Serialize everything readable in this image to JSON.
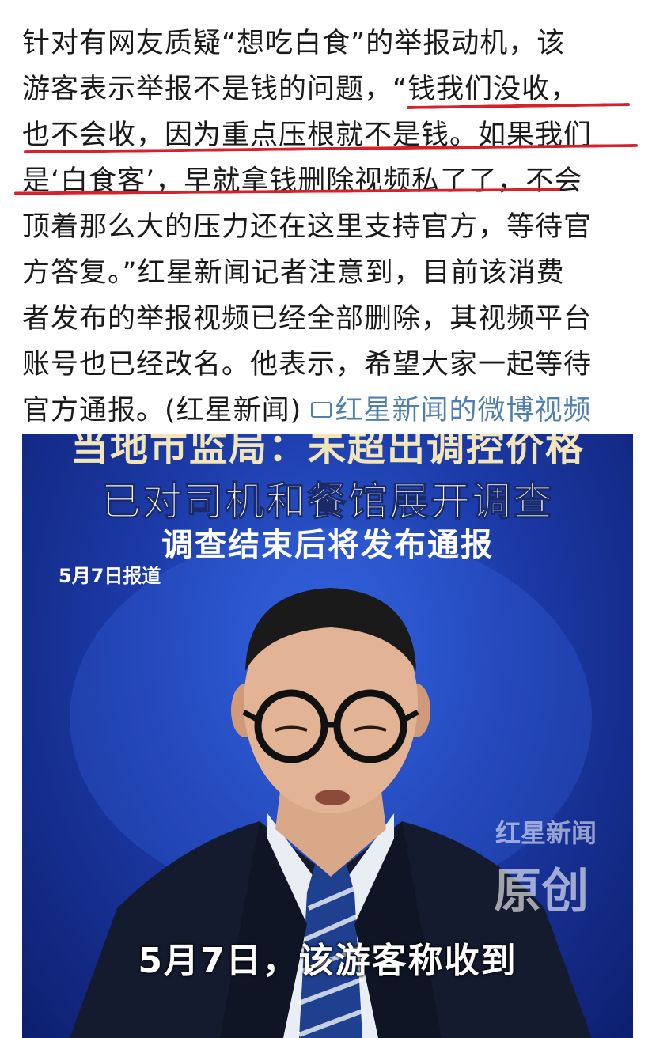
{
  "post": {
    "lines": [
      "针对有网友质疑“想吃白食”的举报动机，该",
      "游客表示举报不是钱的问题，“钱我们没收，",
      "也不会收，因为重点压根就不是钱。如果我们",
      "是‘白食客’，早就拿钱删除视频私了了，不会",
      "顶着那么大的压力还在这里支持官方，等待官",
      "方答复。”红星新闻记者注意到，目前该消费",
      "者发布的举报视频已经全部删除，其视频平台",
      "账号也已经改名。他表示，希望大家一起等待"
    ],
    "last_line_text": "官方通报。(红星新闻)",
    "link_label": "红星新闻的微博视频"
  },
  "video": {
    "headline_top": "当地市监局：未超出调控价格",
    "headline_main": "已对司机和餐馆展开调查",
    "headline_sub": "调查结束后将发布通报",
    "date_tag": "5月7日报道",
    "watermark_brand": "红星新闻",
    "watermark_original": "原创",
    "subtitle": "5月7日，该游客称收到"
  },
  "colors": {
    "underline": "#d8202a",
    "link": "#4f7fb0",
    "video_bg": "#1c3aa8"
  }
}
